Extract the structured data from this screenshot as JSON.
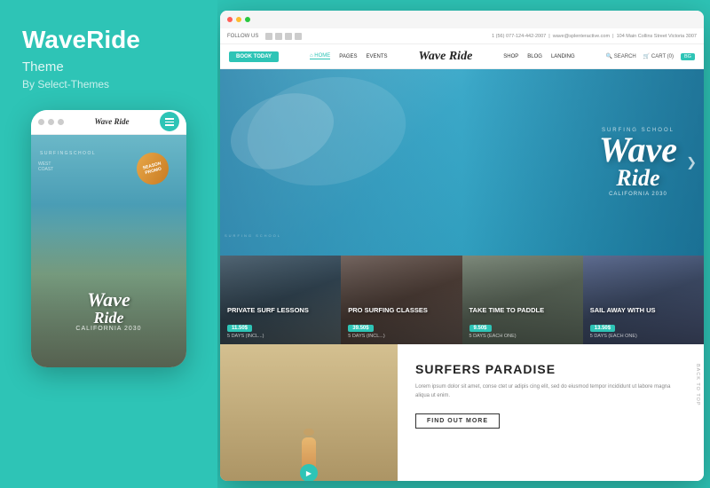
{
  "brand": {
    "title": "WaveRide",
    "subtitle": "Theme",
    "by": "By Select-Themes"
  },
  "mobile": {
    "dots": [
      "dot1",
      "dot2",
      "dot3"
    ],
    "logo": "Wave Ride",
    "wave_text": "Wave",
    "wave_subtext": "Ride",
    "location": "California 2030",
    "badge_line1": "Season",
    "badge_line2": "Promo"
  },
  "desktop": {
    "browser_controls": [
      "red",
      "yellow",
      "green"
    ],
    "top_bar": {
      "follow_us": "FOLLOW US",
      "phone": "1 (56) 077-124-442-2007",
      "email": "wave@splenteractive.com",
      "address": "104 Main Collins Street Victoria 3007"
    },
    "nav": {
      "book_button": "BOOK TODAY",
      "logo": "Wave Ride",
      "links": [
        "HOME",
        "PAGES",
        "EVENTS",
        "SHOP",
        "BLOG",
        "LANDING"
      ],
      "right": [
        "SEARCH",
        "CART (0)",
        "BG"
      ]
    },
    "hero": {
      "school_text": "SURFING SCHOOL",
      "wave_logo": "Wave",
      "ride_text": "Ride",
      "location": "California 2030",
      "nav_arrow": "❯"
    },
    "cards": [
      {
        "title": "PRIVATE SURF LESSONS",
        "price": "11.50$",
        "duration": "5 DAYS (INCL...)"
      },
      {
        "title": "PRO SURFING CLASSES",
        "price": "39.50$",
        "duration": "5 DAYS (INCL...)"
      },
      {
        "title": "TAKE TIME TO PADDLE",
        "price": "9.50$",
        "duration": "5 DAYS (EACH ONE)"
      },
      {
        "title": "SAIL AWAY WITH US",
        "price": "13.50$",
        "duration": "5 DAYS (EACH ONE)"
      }
    ],
    "bottom": {
      "play_icon": "▶",
      "section_title": "SURFERS PARADISE",
      "description": "Lorem ipsum dolor sit amet, conse ctet ur adipis cing elit, sed do eiusmod tempor incididunt ut labore magna aliqua ut enim.",
      "find_out_button": "FIND OUT MORE",
      "back_to_top": "BACK TO TOP"
    }
  }
}
